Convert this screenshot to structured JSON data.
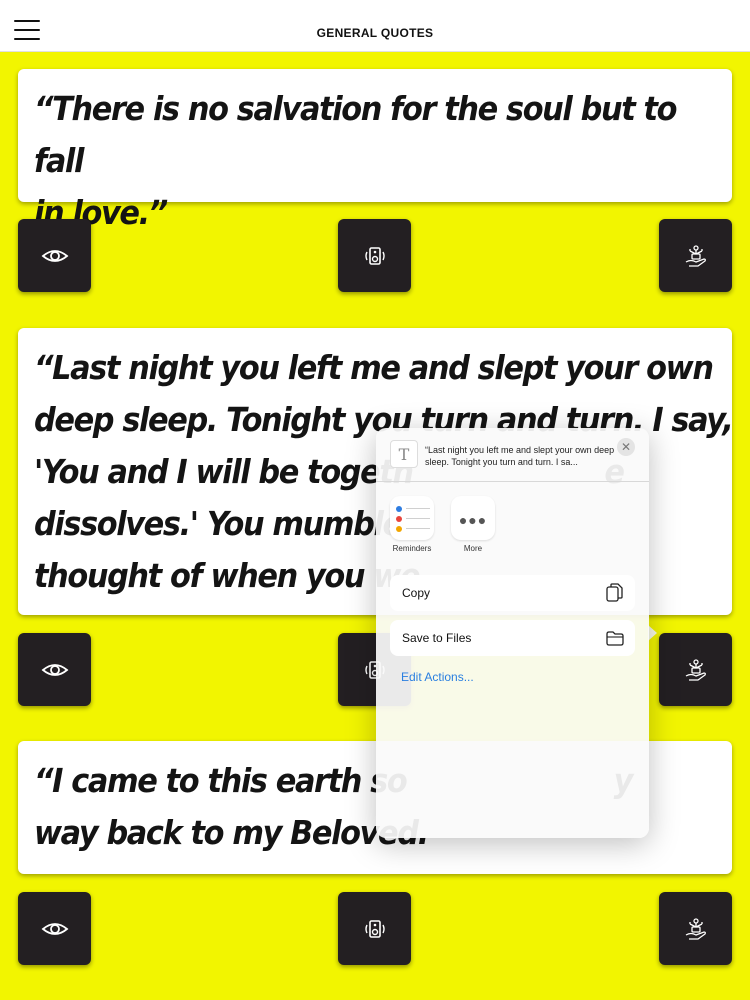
{
  "header": {
    "title": "GENERAL QUOTES"
  },
  "quotes": [
    {
      "line1": "“There is no salvation for the soul but to fall",
      "line2": "in love.”"
    },
    {
      "line1": "“Last night you left me and slept your own",
      "line2": "deep sleep. Tonight you turn and turn. I say,",
      "line3": "'You and I will be togeth",
      "line3b": "e",
      "line4": "dissolves.' You mumble",
      "line5": "thought of when you we"
    },
    {
      "line1": "“I came to this earth so",
      "line1b": "y",
      "line2": "way back to my Beloved."
    }
  ],
  "buttons": {
    "view_icon": "eye-icon",
    "speak_icon": "speaker-icon",
    "share_icon": "share-hand-icon"
  },
  "share_sheet": {
    "preview_text": "“Last night you left me and slept your own deep sleep. Tonight you turn and turn. I sa...",
    "text_icon_glyph": "T",
    "close_glyph": "✕",
    "apps": [
      {
        "label": "Reminders",
        "icon": "reminders-icon"
      },
      {
        "label": "More",
        "icon": "more-icon"
      }
    ],
    "actions": [
      {
        "label": "Copy",
        "icon": "copy-icon"
      },
      {
        "label": "Save to Files",
        "icon": "folder-icon"
      }
    ],
    "edit_actions": "Edit Actions...",
    "reminder_colors": [
      "#2f7de1",
      "#e8453c",
      "#f2a600"
    ]
  },
  "colors": {
    "background": "#f2f500",
    "button": "#231f22",
    "link": "#2a7fe0"
  }
}
